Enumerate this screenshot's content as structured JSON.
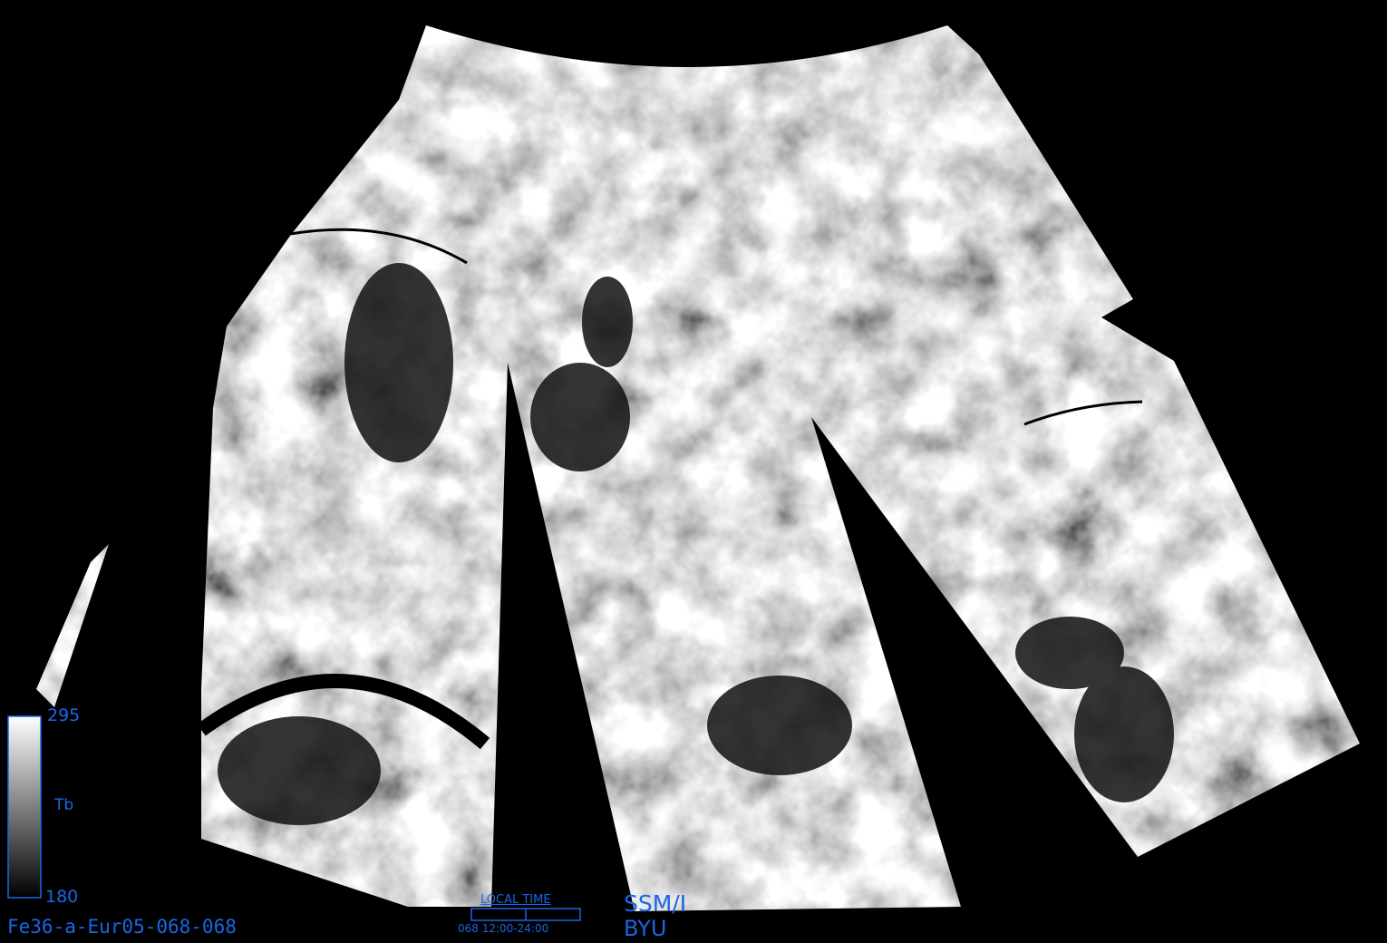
{
  "colorbar": {
    "max_label": "295",
    "min_label": "180",
    "variable": "Tb",
    "gradient_top": "#ffffff",
    "gradient_bottom": "#000000",
    "frame_color": "#1a66e6"
  },
  "file_id": "Fe36-a-Eur05-068-068",
  "local_time": {
    "title": "LOCAL TIME",
    "range": "068 12:00-24:00"
  },
  "sensor": "SSM/I",
  "institution": "BYU",
  "label_color": "#1a66e6",
  "background_color": "#000000"
}
